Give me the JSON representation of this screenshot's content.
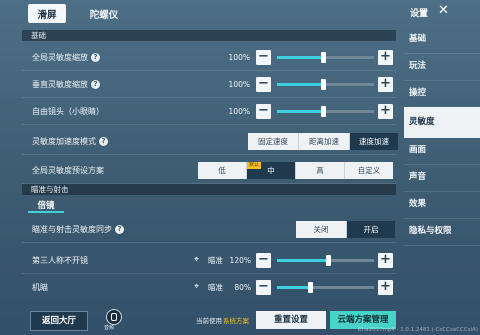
{
  "tabs": {
    "touch": "滑屏",
    "gyro": "陀螺仪"
  },
  "sections": {
    "basic": "基础",
    "aim": "瞄准与射击"
  },
  "rows": {
    "global_zoom": {
      "label": "全局灵敏度缩放",
      "value": "100%"
    },
    "vertical_zoom": {
      "label": "垂直灵敏度缩放",
      "value": "100%"
    },
    "free_look": {
      "label": "自由镜头（小眼睛）",
      "value": "100%"
    },
    "accel_mode": {
      "label": "灵敏度加速度模式",
      "options": [
        "固定速度",
        "距离加速",
        "速度加速"
      ],
      "selected": "速度加速"
    },
    "preset": {
      "label": "全局灵敏度预设方案",
      "options": [
        "低",
        "中",
        "高",
        "自定义"
      ],
      "selected": "中",
      "badge": "默认"
    },
    "scope_tab": "倍镜",
    "aim_sync": {
      "label": "瞄准与射击灵敏度同步",
      "options": [
        "关闭",
        "开启"
      ],
      "selected": "开启"
    },
    "tpp_noscope": {
      "label": "第三人称不开镜",
      "prefix": "瞄准",
      "value": "120%"
    },
    "mech_sight": {
      "label": "机瞄",
      "prefix": "瞄准",
      "value": "80%"
    }
  },
  "slider_levels": {
    "global_zoom": 0.48,
    "vertical_zoom": 0.48,
    "free_look": 0.48,
    "tpp_noscope": 0.53,
    "mech_sight": 0.35
  },
  "bottom": {
    "back_lobby": "返回大厅",
    "voice": "音频",
    "current_using": "当前使用",
    "current_scheme": "系统方案",
    "reset": "重置设置",
    "cloud": "云端方案管理"
  },
  "sidebar": {
    "title": "设置",
    "items": [
      "基础",
      "玩法",
      "操控",
      "灵敏度",
      "画面",
      "声音",
      "效果",
      "隐私与权限"
    ],
    "active": 3
  },
  "watermark": "ID:a2017mp4 · 1.0.1.2481 (·CsCCsaCCCsiA)",
  "colors": {
    "accent": "#3fd0e0",
    "cloud_btn": "#49d3c8"
  }
}
